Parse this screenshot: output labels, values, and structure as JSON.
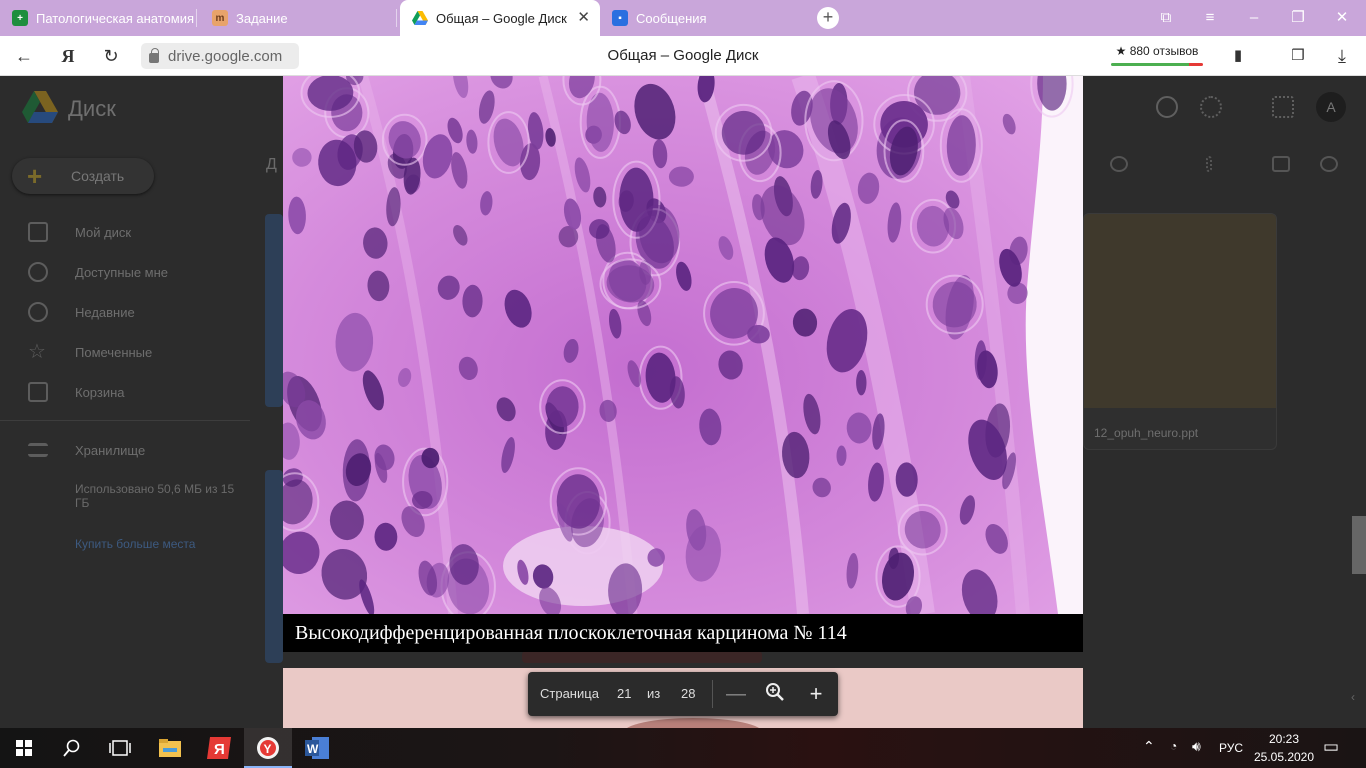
{
  "browser": {
    "tabs": [
      {
        "title": "Патологическая анатомия",
        "favicon": "sheets-icon"
      },
      {
        "title": "Задание",
        "favicon": "task-icon"
      },
      {
        "title": "Общая – Google Диск",
        "favicon": "google-drive-icon",
        "active": true
      },
      {
        "title": "Сообщения",
        "favicon": "messages-icon"
      }
    ],
    "url": "drive.google.com",
    "page_title": "Общая – Google Диск",
    "reviews_label": "★ 880 отзывов",
    "window_controls": [
      "tabs-icon",
      "menu-icon",
      "minimize-icon",
      "restore-icon",
      "close-icon"
    ]
  },
  "drive": {
    "brand": "Диск",
    "create_label": "Создать",
    "breadcrumb_initial": "Д",
    "sidebar": [
      {
        "label": "Мой диск",
        "icon": "my-drive-icon"
      },
      {
        "label": "Доступные мне",
        "icon": "shared-icon"
      },
      {
        "label": "Недавние",
        "icon": "recent-icon"
      },
      {
        "label": "Помеченные",
        "icon": "starred-icon"
      },
      {
        "label": "Корзина",
        "icon": "trash-icon"
      }
    ],
    "storage_label": "Хранилище",
    "storage_used": "Использовано 50,6 МБ из 15 ГБ",
    "buy_storage": "Купить больше места",
    "avatar_letter": "A",
    "file_name": "12_opuh_neuro.ppt"
  },
  "viewer": {
    "caption": "Высокодифференцированная плоскоклеточная карцинома № 114",
    "page_label": "Страница",
    "page_current": "21",
    "page_of": "из",
    "page_total": "28",
    "zoom_out": "—",
    "zoom_in": "+"
  },
  "taskbar": {
    "apps": [
      "windows-start-icon",
      "search-icon",
      "task-view-icon",
      "file-explorer-icon",
      "yandex-icon",
      "yandex-browser-icon",
      "word-icon"
    ],
    "language": "РУС",
    "time": "20:23",
    "date": "25.05.2020"
  },
  "colors": {
    "tab_strip": "#c9a6da",
    "slide_background": "#d386d9",
    "nucleus": "#6a2e8c",
    "caption_bg": "#000000"
  }
}
